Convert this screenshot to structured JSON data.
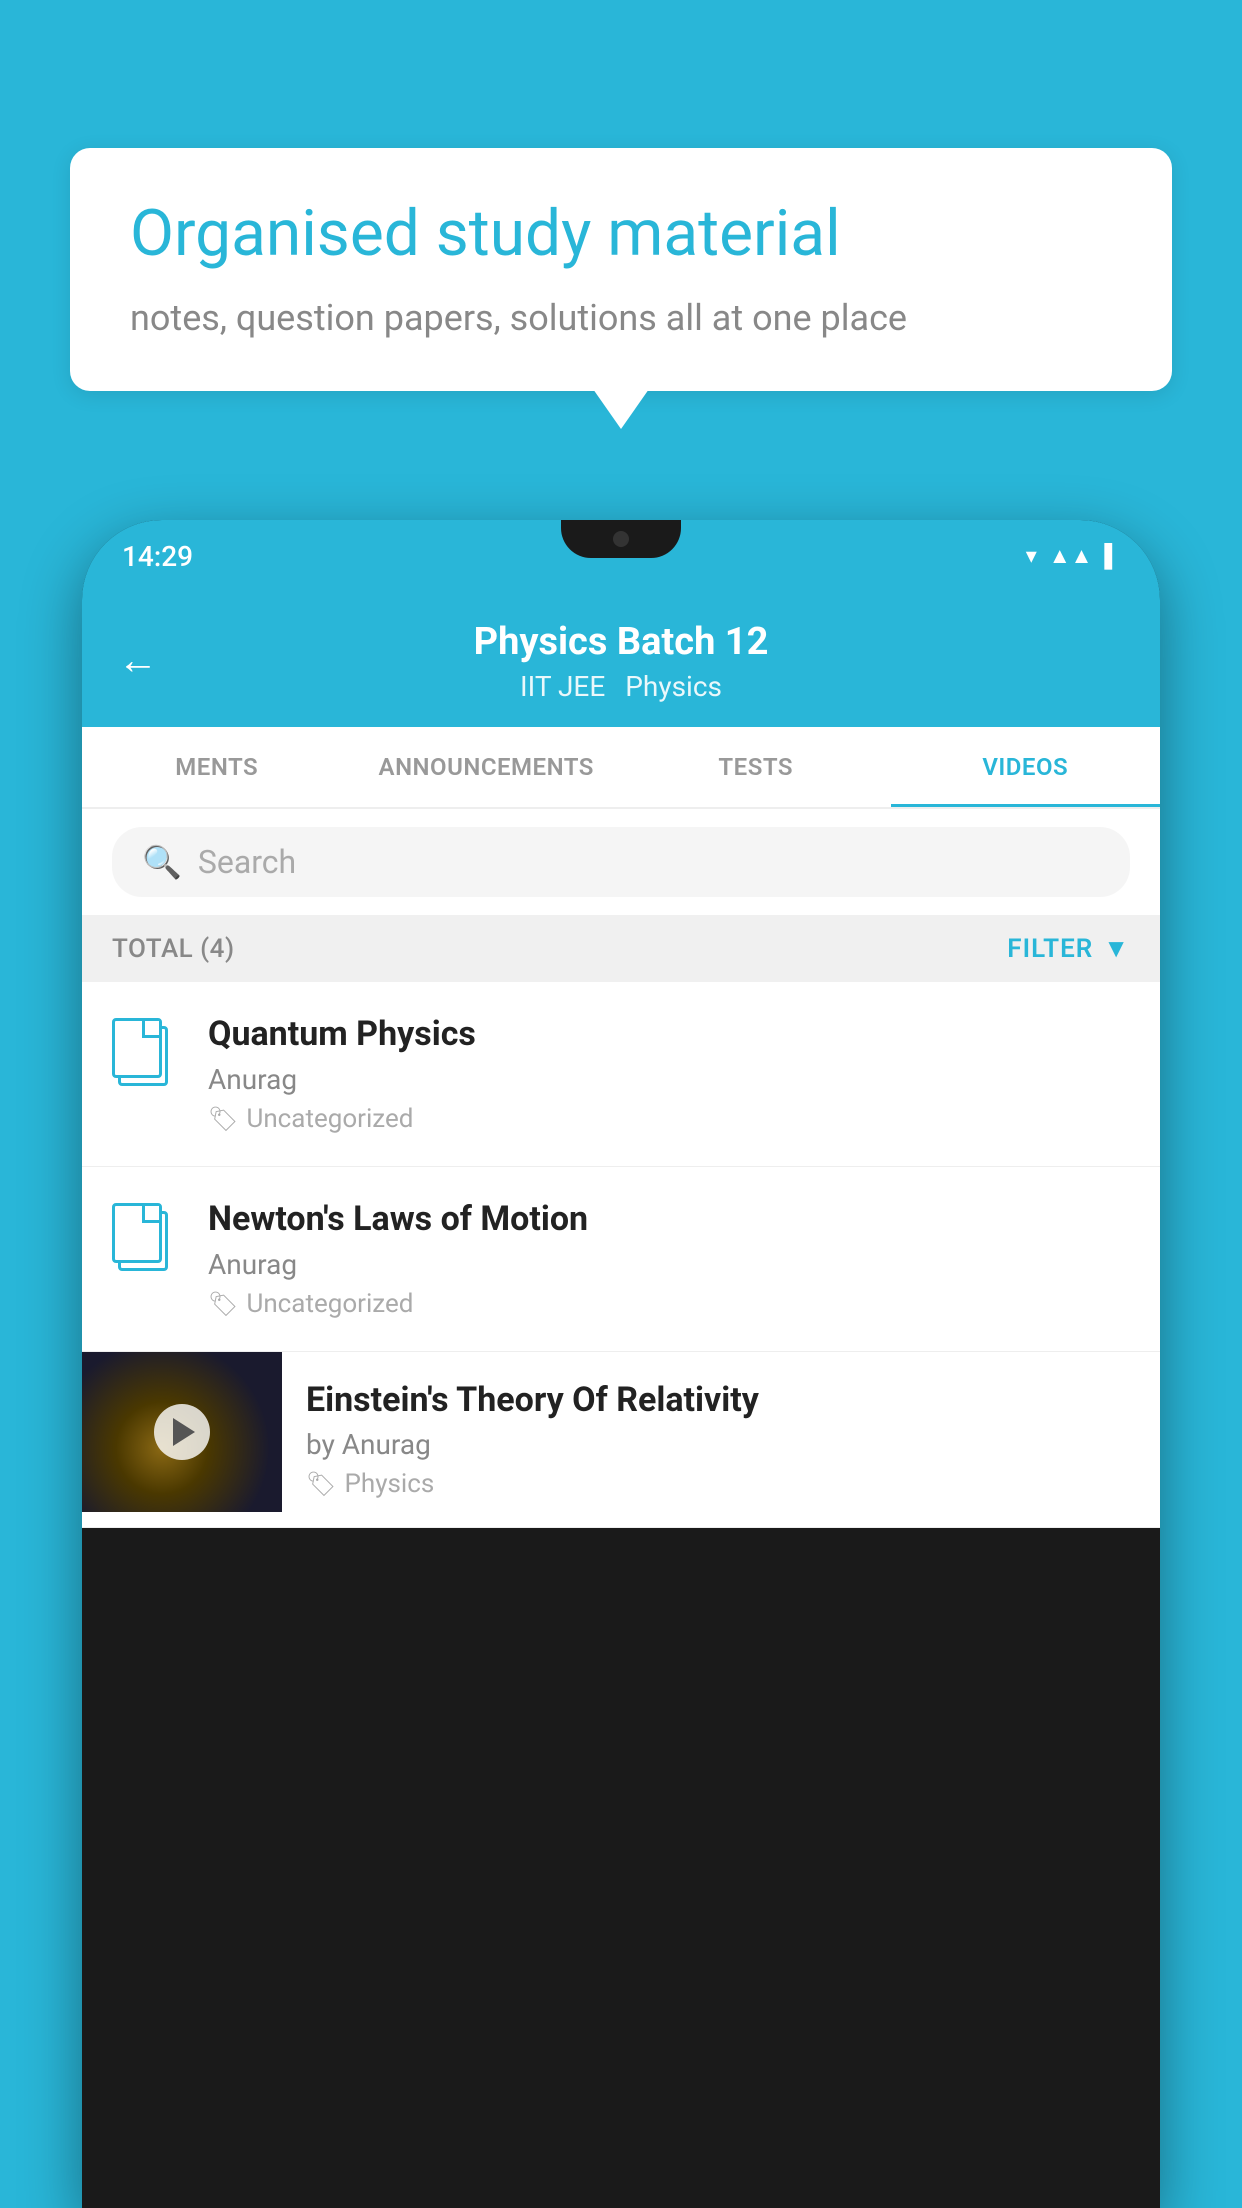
{
  "background": {
    "color": "#29B6D8"
  },
  "speech_bubble": {
    "title": "Organised study material",
    "subtitle": "notes, question papers, solutions all at one place"
  },
  "phone": {
    "status_bar": {
      "time": "14:29"
    },
    "header": {
      "back_label": "←",
      "title": "Physics Batch 12",
      "tags": [
        "IIT JEE",
        "Physics"
      ]
    },
    "tabs": [
      {
        "label": "MENTS",
        "active": false
      },
      {
        "label": "ANNOUNCEMENTS",
        "active": false
      },
      {
        "label": "TESTS",
        "active": false
      },
      {
        "label": "VIDEOS",
        "active": true
      }
    ],
    "search": {
      "placeholder": "Search"
    },
    "filter_row": {
      "total_label": "TOTAL (4)",
      "filter_label": "FILTER"
    },
    "videos": [
      {
        "title": "Quantum Physics",
        "author": "Anurag",
        "tag": "Uncategorized",
        "has_thumb": false
      },
      {
        "title": "Newton's Laws of Motion",
        "author": "Anurag",
        "tag": "Uncategorized",
        "has_thumb": false
      },
      {
        "title": "Einstein's Theory Of Relativity",
        "author": "by Anurag",
        "tag": "Physics",
        "has_thumb": true
      }
    ]
  }
}
